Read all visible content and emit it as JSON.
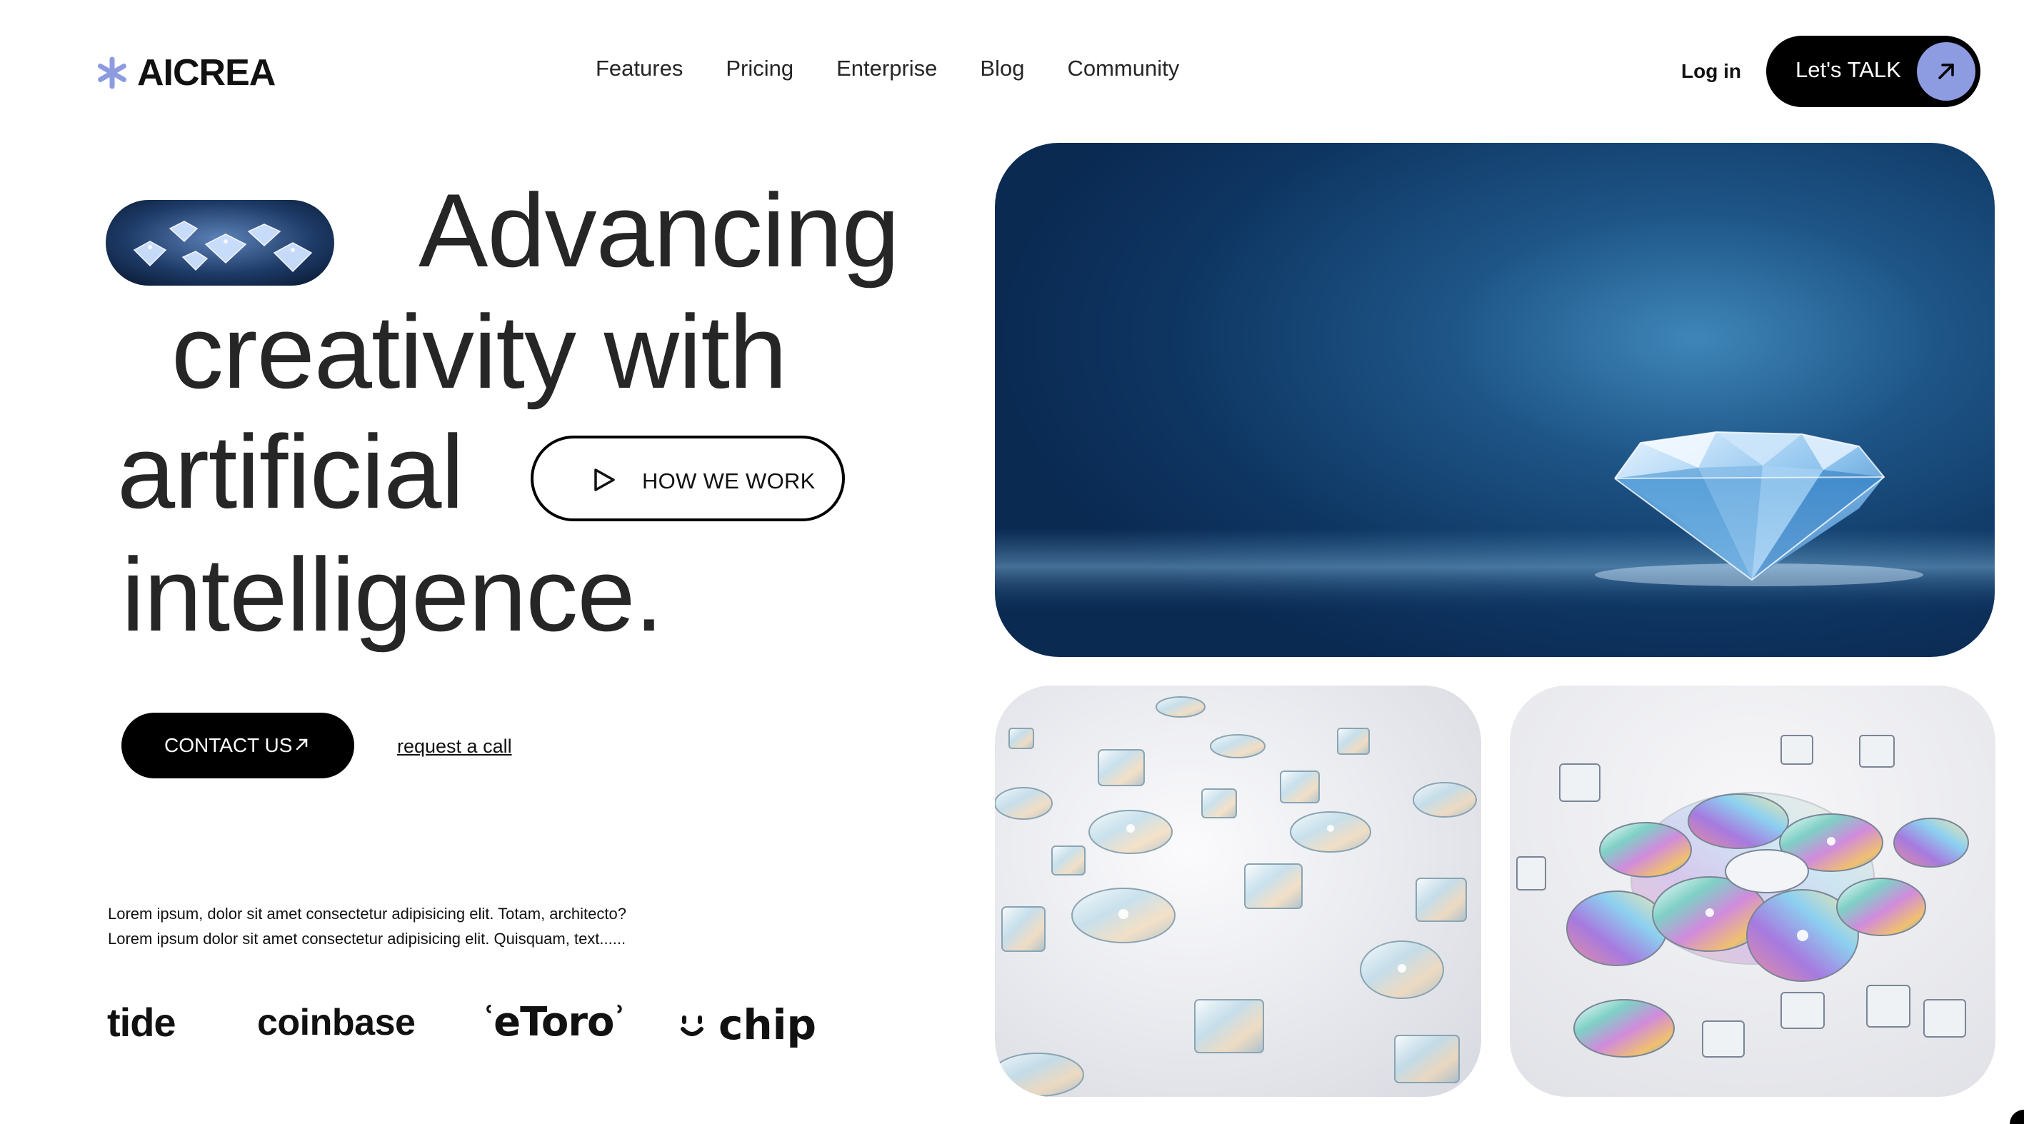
{
  "header": {
    "logo_text": "AICREA",
    "logo_icon": "asterisk-icon",
    "nav": [
      {
        "label": "Features"
      },
      {
        "label": "Pricing"
      },
      {
        "label": "Enterprise"
      },
      {
        "label": "Blog"
      },
      {
        "label": "Community"
      }
    ],
    "login_label": "Log in",
    "cta_label": "Let's TALK",
    "cta_icon": "arrow-up-right-icon",
    "accent_color": "#8d9be0"
  },
  "hero": {
    "line1": "Advancing",
    "line2": "creativity with",
    "line3": "artificial",
    "line4": "intelligence.",
    "how_label": "HOW WE WORK",
    "how_icon": "play-icon",
    "contact_label": "CONTACT US",
    "contact_icon": "arrow-up-right-icon",
    "request_label": "request a call"
  },
  "description": {
    "line1": "Lorem ipsum, dolor sit amet consectetur adipisicing elit. Totam, architecto?",
    "line2": "Lorem ipsum dolor sit amet consectetur adipisicing elit. Quisquam, text......"
  },
  "brands": {
    "tide": "tide",
    "coinbase": "coinbase",
    "etoro": "eToro",
    "chip": "chip"
  }
}
